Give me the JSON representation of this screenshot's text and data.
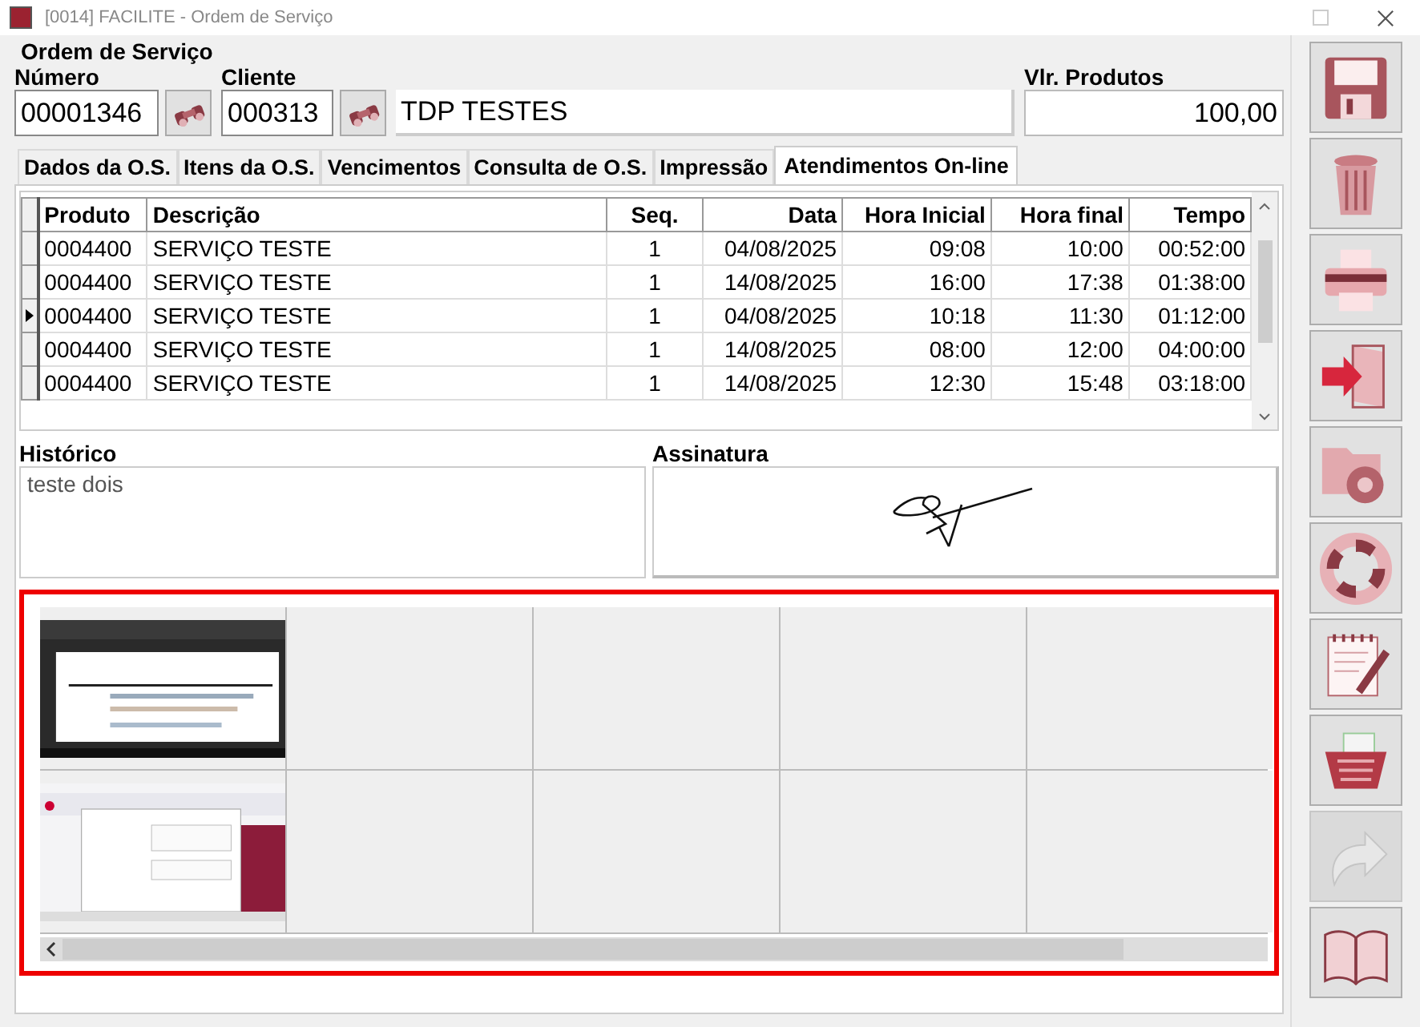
{
  "window": {
    "title": "[0014] FACILITE - Ordem de Serviço"
  },
  "header": {
    "title": "Ordem de Serviço",
    "numero": {
      "label": "Número",
      "value": "00001346"
    },
    "cliente": {
      "label": "Cliente",
      "code": "000313",
      "name": "TDP TESTES"
    },
    "vlr_produtos": {
      "label": "Vlr. Produtos",
      "value": "100,00"
    }
  },
  "tabs": [
    {
      "label": "Dados da O.S.",
      "selected": false
    },
    {
      "label": "Itens da O.S.",
      "selected": false
    },
    {
      "label": "Vencimentos",
      "selected": false
    },
    {
      "label": "Consulta de O.S.",
      "selected": false
    },
    {
      "label": "Impressão",
      "selected": false
    },
    {
      "label": "Atendimentos On-line",
      "selected": true
    }
  ],
  "table": {
    "columns": [
      "Produto",
      "Descrição",
      "Seq.",
      "Data",
      "Hora Inicial",
      "Hora final",
      "Tempo"
    ],
    "rows": [
      {
        "cells": [
          "0004400",
          "SERVIÇO TESTE",
          "1",
          "04/08/2025",
          "09:08",
          "10:00",
          "00:52:00"
        ],
        "selected": false
      },
      {
        "cells": [
          "0004400",
          "SERVIÇO TESTE",
          "1",
          "14/08/2025",
          "16:00",
          "17:38",
          "01:38:00"
        ],
        "selected": false
      },
      {
        "cells": [
          "0004400",
          "SERVIÇO TESTE",
          "1",
          "04/08/2025",
          "10:18",
          "11:30",
          "01:12:00"
        ],
        "selected": true
      },
      {
        "cells": [
          "0004400",
          "SERVIÇO TESTE",
          "1",
          "14/08/2025",
          "08:00",
          "12:00",
          "04:00:00"
        ],
        "selected": false
      },
      {
        "cells": [
          "0004400",
          "SERVIÇO TESTE",
          "1",
          "14/08/2025",
          "12:30",
          "15:48",
          "03:18:00"
        ],
        "selected": false
      }
    ]
  },
  "historico": {
    "label": "Histórico",
    "value": "teste dois"
  },
  "assinatura": {
    "label": "Assinatura"
  },
  "gallery": {
    "rows": [
      [
        {
          "kind": "picture"
        },
        {
          "kind": "empty"
        },
        {
          "kind": "empty"
        },
        {
          "kind": "empty"
        },
        {
          "kind": "empty"
        }
      ],
      [
        {
          "kind": "picture"
        },
        {
          "kind": "empty"
        },
        {
          "kind": "empty"
        },
        {
          "kind": "empty"
        },
        {
          "kind": "empty"
        }
      ]
    ]
  },
  "toolbar": [
    {
      "kind": "save",
      "disabled": false
    },
    {
      "kind": "trash",
      "disabled": false
    },
    {
      "kind": "print",
      "disabled": false
    },
    {
      "kind": "exit",
      "disabled": false
    },
    {
      "kind": "folder-gear",
      "disabled": false
    },
    {
      "kind": "lifebuoy",
      "disabled": false
    },
    {
      "kind": "notepad",
      "disabled": false
    },
    {
      "kind": "basket",
      "disabled": false
    },
    {
      "kind": "share",
      "disabled": true
    },
    {
      "kind": "book",
      "disabled": false
    }
  ]
}
